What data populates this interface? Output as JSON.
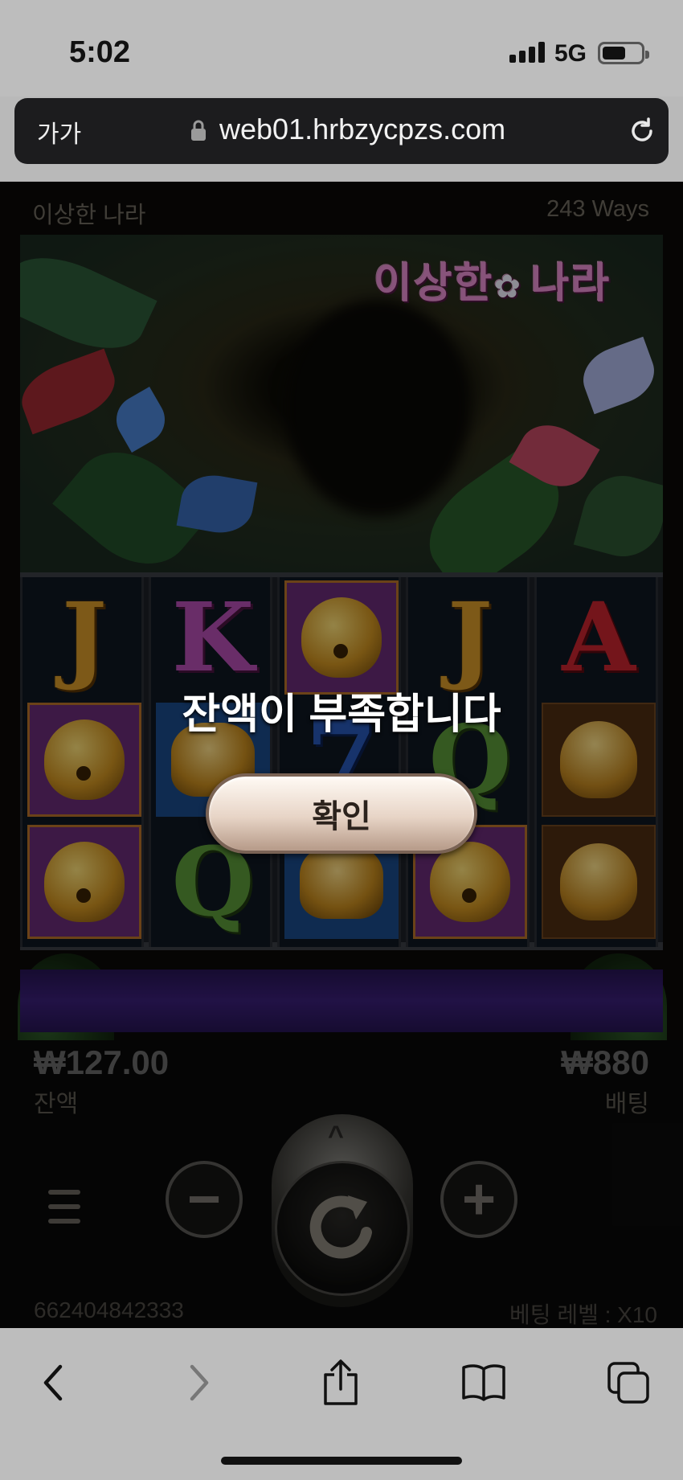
{
  "status": {
    "time": "5:02",
    "network": "5G"
  },
  "browser": {
    "text_size_label": "가가",
    "url": "web01.hrbzycpzs.com"
  },
  "game": {
    "title": "이상한 나라",
    "ways": "243 Ways",
    "logo_text": "이상한 나라",
    "reels": [
      [
        "J",
        "bell",
        "bell"
      ],
      [
        "K",
        "lamp",
        "Q"
      ],
      [
        "bell",
        "7",
        "lamp"
      ],
      [
        "J",
        "Q",
        "bell"
      ],
      [
        "A",
        "spade",
        "spade"
      ]
    ],
    "balance": {
      "value": "₩127.00",
      "label": "잔액"
    },
    "bet": {
      "value": "₩880",
      "label": "배팅"
    },
    "controls": {
      "minus": "−",
      "plus": "+",
      "spin_up": "^"
    },
    "round_id": "662404842333",
    "bet_level": "베팅 레벨 : X10"
  },
  "modal": {
    "message": "잔액이 부족합니다",
    "confirm_label": "확인"
  },
  "colors": {
    "accent_gold": "#d79a2a",
    "reel_purple": "#6a2c78",
    "band_purple": "#3a1f78"
  }
}
